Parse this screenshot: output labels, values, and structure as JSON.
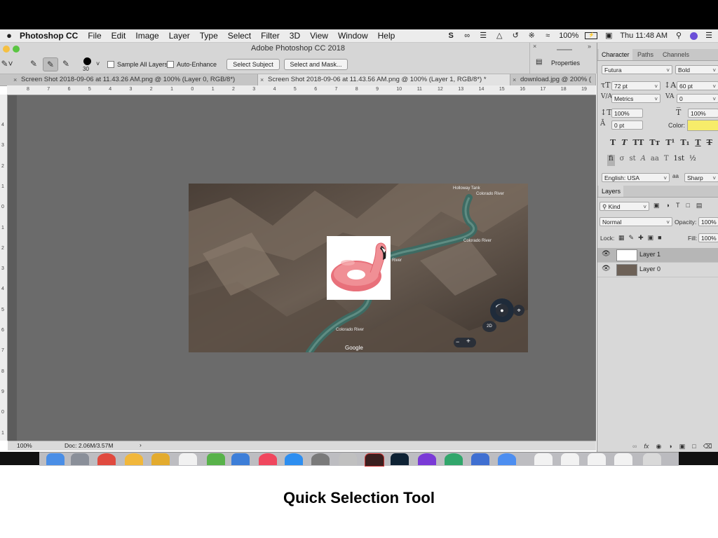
{
  "menubar": {
    "apple": "",
    "app_name": "Photoshop CC",
    "menus": [
      "File",
      "Edit",
      "Image",
      "Layer",
      "Type",
      "Select",
      "Filter",
      "3D",
      "View",
      "Window",
      "Help"
    ],
    "status": {
      "battery": "100%",
      "clock": "Thu 11:48 AM"
    }
  },
  "window": {
    "title": "Adobe Photoshop CC 2018"
  },
  "options_bar": {
    "brush_size": "30",
    "sample_all_layers": "Sample All Layers",
    "auto_enhance": "Auto-Enhance",
    "select_subject": "Select Subject",
    "select_and_mask": "Select and Mask..."
  },
  "properties_panel": {
    "label": "Properties"
  },
  "doc_tabs": [
    {
      "label": "Screen Shot 2018-09-06 at 11.43.26 AM.png @ 100% (Layer 0, RGB/8*)",
      "active": false
    },
    {
      "label": "Screen Shot 2018-09-06 at 11.43.56 AM.png @ 100% (Layer 1, RGB/8*) *",
      "active": true
    },
    {
      "label": "download.jpg @ 200% (",
      "active": false
    }
  ],
  "ruler": {
    "h": [
      "8",
      "7",
      "6",
      "5",
      "4",
      "3",
      "2",
      "1",
      "0",
      "1",
      "2",
      "3",
      "4",
      "5",
      "6",
      "7",
      "8",
      "9",
      "10",
      "11",
      "12",
      "13",
      "14",
      "15",
      "16",
      "17",
      "18",
      "19"
    ],
    "v": [
      "4",
      "3",
      "2",
      "1",
      "0",
      "1",
      "2",
      "3",
      "4",
      "5",
      "6",
      "7",
      "8",
      "9",
      "0",
      "1"
    ]
  },
  "map": {
    "labels": [
      "Holloway Tank",
      "Colorado River",
      "Colorado River",
      "Colorado River",
      "River"
    ],
    "google": "Google",
    "btn_2d": "2D",
    "zoom_minus": "−",
    "zoom_plus": "+"
  },
  "statusbar": {
    "zoom": "100%",
    "doc": "Doc: 2.06M/3.57M"
  },
  "character_panel": {
    "tabs": [
      "Character",
      "Paths",
      "Channels"
    ],
    "font_family": "Futura",
    "font_style": "Bold",
    "font_size": "72 pt",
    "leading": "60 pt",
    "kerning": "Metrics",
    "tracking": "0",
    "vertical_scale": "100%",
    "horizontal_scale": "100%",
    "baseline_shift": "0 pt",
    "color_label": "Color:",
    "color_value": "#f7ec6a",
    "language": "English: USA",
    "aa_label": "a",
    "antialias": "Sharp"
  },
  "layers_panel": {
    "tab": "Layers",
    "kind": "Kind",
    "blend_mode": "Normal",
    "opacity_label": "Opacity:",
    "opacity": "100%",
    "lock_label": "Lock:",
    "fill_label": "Fill:",
    "fill": "100%",
    "layers": [
      {
        "name": "Layer 1",
        "selected": true
      },
      {
        "name": "Layer 0",
        "selected": false
      }
    ]
  },
  "caption": "Quick Selection Tool"
}
